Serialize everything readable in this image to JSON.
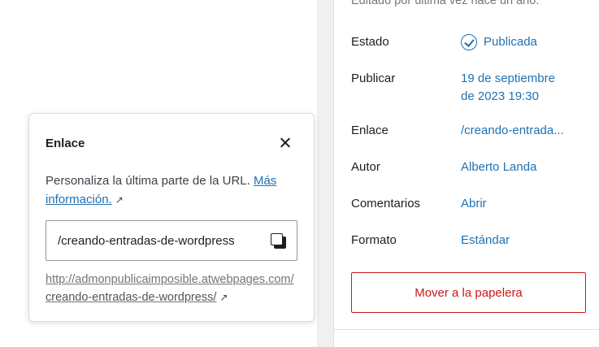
{
  "sidebar": {
    "last_edited": "Editado por última vez hace un año.",
    "rows": [
      {
        "label": "Estado",
        "value": "Publicada",
        "icon": "check-circle-icon"
      },
      {
        "label": "Publicar",
        "value": "19 de septiembre",
        "value2": "de 2023 19:30"
      },
      {
        "label": "Enlace",
        "value": "/creando-entrada..."
      },
      {
        "label": "Autor",
        "value": "Alberto Landa"
      },
      {
        "label": "Comentarios",
        "value": "Abrir"
      },
      {
        "label": "Formato",
        "value": "Estándar"
      }
    ],
    "trash_label": "Mover a la papelera",
    "accent_color": "#2271b1",
    "danger_color": "#cc1818"
  },
  "popover": {
    "title": "Enlace",
    "description": "Personaliza la última parte de la URL.",
    "more_info": "Más información.",
    "url_value": "/creando-entradas-de-wordpress",
    "full_url_base": "http://admonpublicaimposible.atwebpages.com/",
    "full_url_slug": "creando-entradas-de-wordpress/",
    "external_icon": "↗"
  }
}
